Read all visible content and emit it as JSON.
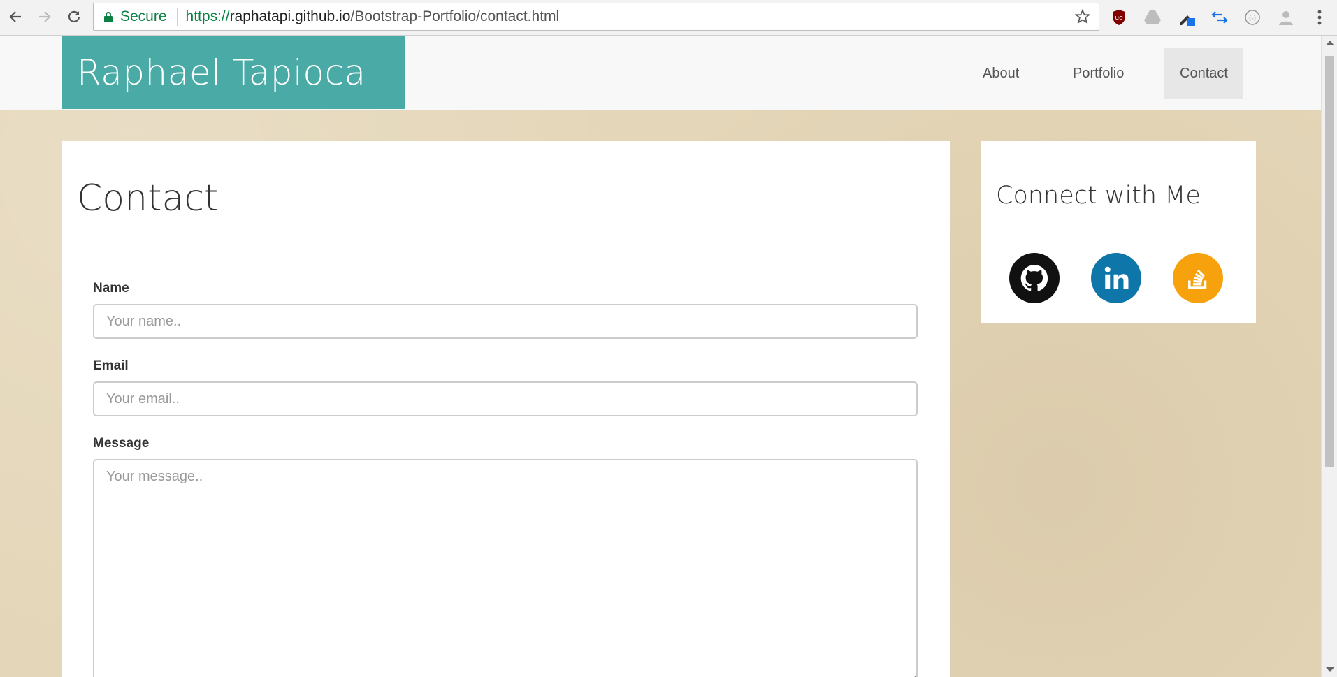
{
  "browser": {
    "secure_label": "Secure",
    "url_scheme": "https://",
    "url_host": "raphatapi.github.io",
    "url_path": "/Bootstrap-Portfolio/contact.html",
    "icons": [
      "back-icon",
      "forward-icon",
      "reload-icon",
      "lock-icon",
      "star-icon",
      "ublock-icon",
      "drive-icon",
      "eyedropper-icon",
      "arrows-icon",
      "circle-ext-icon",
      "profile-icon",
      "menu-icon"
    ]
  },
  "navbar": {
    "brand": "Raphael Tapioca",
    "links": [
      {
        "label": "About"
      },
      {
        "label": "Portfolio"
      },
      {
        "label": "Contact",
        "active": true
      }
    ],
    "brand_color": "#4aaba6"
  },
  "contact": {
    "title": "Contact",
    "fields": {
      "name": {
        "label": "Name",
        "placeholder": "Your name.."
      },
      "email": {
        "label": "Email",
        "placeholder": "Your email.."
      },
      "message": {
        "label": "Message",
        "placeholder": "Your message.."
      }
    }
  },
  "sidebar": {
    "title": "Connect with Me",
    "social": [
      {
        "icon": "github-icon",
        "color": "#111111"
      },
      {
        "icon": "linkedin-icon",
        "color": "#0e76a8"
      },
      {
        "icon": "stackoverflow-icon",
        "color": "#f7a20c"
      }
    ]
  }
}
